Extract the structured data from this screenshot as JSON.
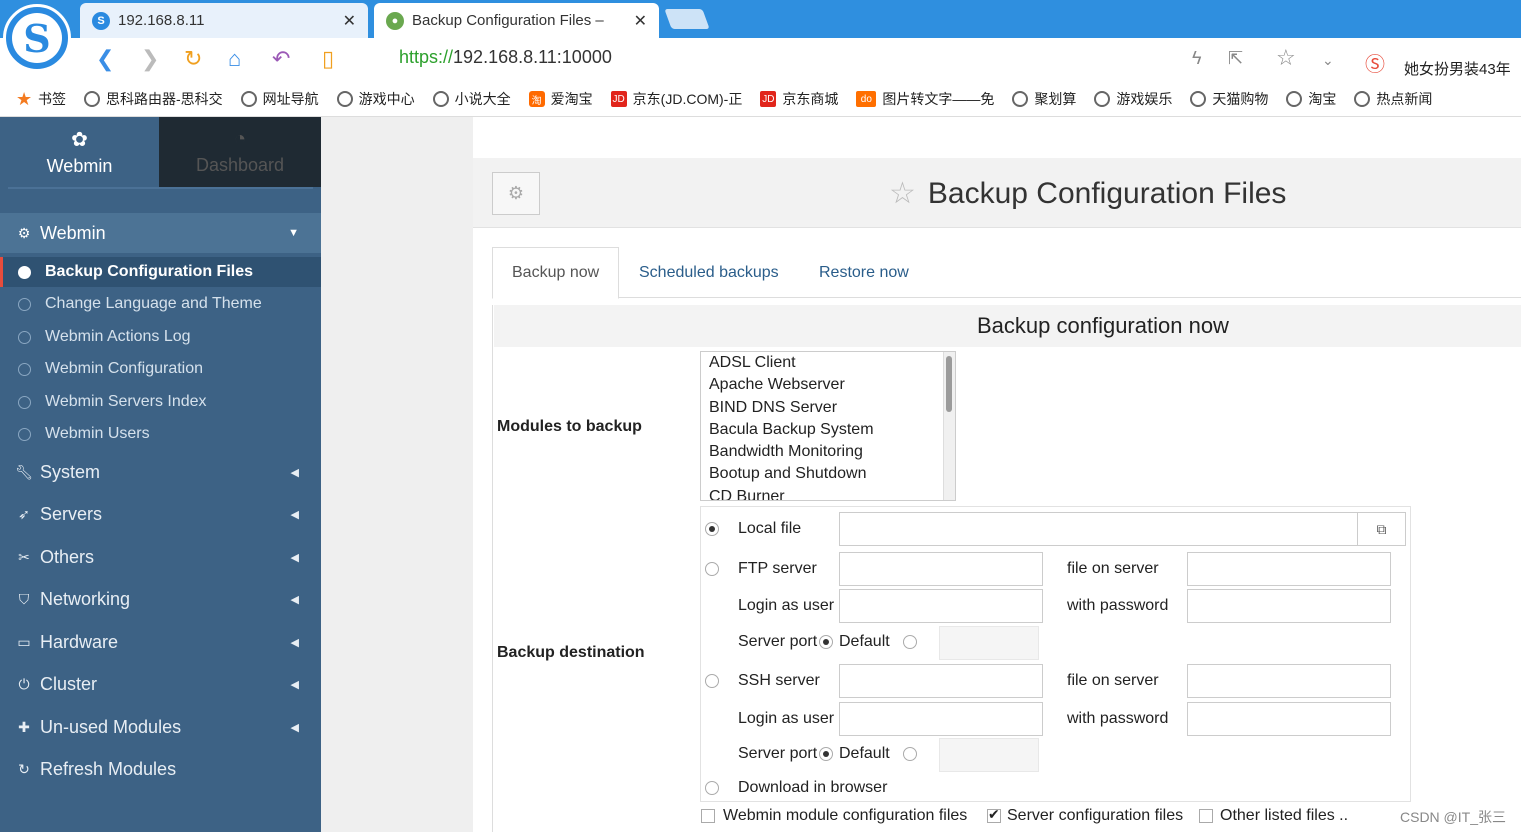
{
  "browser": {
    "tabs": [
      {
        "title": "192.168.8.11"
      },
      {
        "title": "Backup Configuration Files –"
      }
    ],
    "url_scheme": "https://",
    "url_rest": "192.168.8.11:10000",
    "news_text": "她女扮男装43年",
    "logo_letter": "S",
    "bookmarks": [
      {
        "label": "书签",
        "icon": "star"
      },
      {
        "label": "思科路由器-思科交",
        "icon": "globe"
      },
      {
        "label": "网址导航",
        "icon": "globe"
      },
      {
        "label": "游戏中心",
        "icon": "globe"
      },
      {
        "label": "小说大全",
        "icon": "globe"
      },
      {
        "label": "爱淘宝",
        "icon": "tao"
      },
      {
        "label": "京东(JD.COM)-正",
        "icon": "jd"
      },
      {
        "label": "京东商城",
        "icon": "jd"
      },
      {
        "label": "图片转文字——免",
        "icon": "do"
      },
      {
        "label": "聚划算",
        "icon": "globe"
      },
      {
        "label": "游戏娱乐",
        "icon": "globe"
      },
      {
        "label": "天猫购物",
        "icon": "globe"
      },
      {
        "label": "淘宝",
        "icon": "globe"
      },
      {
        "label": "热点新闻",
        "icon": "globe"
      }
    ]
  },
  "sidebar": {
    "webmin_tab": "Webmin",
    "dashboard_tab": "Dashboard",
    "open_category": "Webmin",
    "items": [
      "Backup Configuration Files",
      "Change Language and Theme",
      "Webmin Actions Log",
      "Webmin Configuration",
      "Webmin Servers Index",
      "Webmin Users"
    ],
    "categories": [
      {
        "label": "System",
        "icon": "wrench-icon"
      },
      {
        "label": "Servers",
        "icon": "rocket-icon"
      },
      {
        "label": "Others",
        "icon": "tools-icon"
      },
      {
        "label": "Networking",
        "icon": "shield-icon"
      },
      {
        "label": "Hardware",
        "icon": "hdd-icon"
      },
      {
        "label": "Cluster",
        "icon": "power-icon"
      },
      {
        "label": "Un-used Modules",
        "icon": "puzzle-icon"
      },
      {
        "label": "Refresh Modules",
        "icon": "refresh-icon"
      }
    ]
  },
  "main": {
    "title": "Backup Configuration Files",
    "tabs": [
      "Backup now",
      "Scheduled backups",
      "Restore now"
    ],
    "section_title": "Backup configuration now",
    "modules_label": "Modules to backup",
    "modules": [
      "ADSL Client",
      "Apache Webserver",
      "BIND DNS Server",
      "Bacula Backup System",
      "Bandwidth Monitoring",
      "Bootup and Shutdown",
      "CD Burner"
    ],
    "destination_label": "Backup destination",
    "local_file": "Local file",
    "ftp_server": "FTP server",
    "ssh_server": "SSH server",
    "file_on_server": "file on server",
    "login_as_user": "Login as user",
    "with_password": "with password",
    "server_port": "Server port",
    "default": "Default",
    "download": "Download in browser",
    "include_webmin": "Webmin module configuration files",
    "include_server": "Server configuration files",
    "include_other": "Other listed files .."
  },
  "watermark": "CSDN @IT_张三"
}
